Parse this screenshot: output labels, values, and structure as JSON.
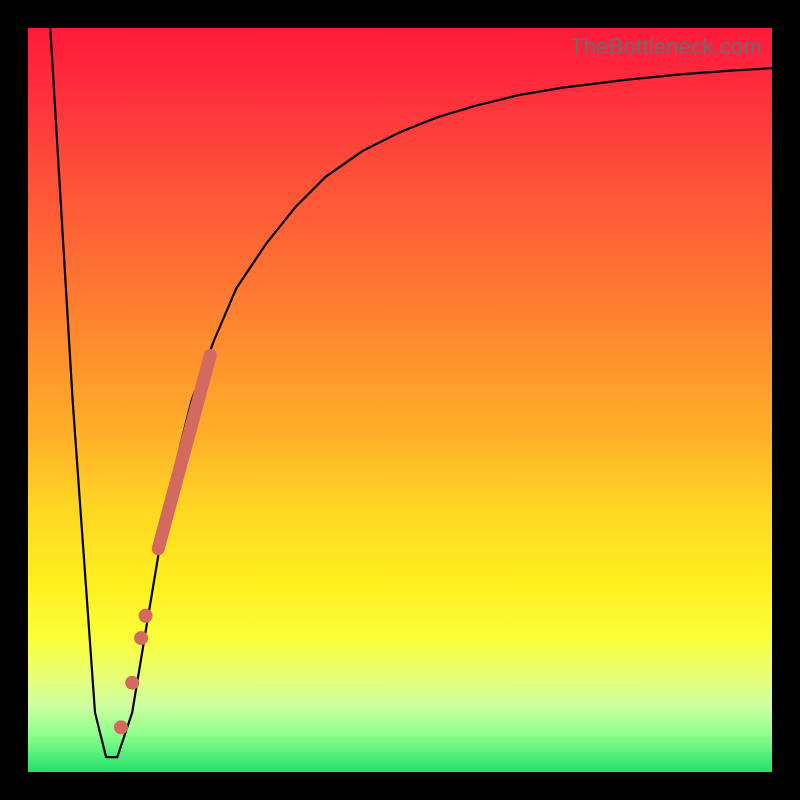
{
  "watermark": "TheBottleneck.com",
  "chart_data": {
    "type": "line",
    "title": "",
    "xlabel": "",
    "ylabel": "",
    "xlim": [
      0,
      100
    ],
    "ylim": [
      0,
      100
    ],
    "grid": false,
    "series": [
      {
        "name": "bottleneck-curve",
        "x": [
          3,
          6,
          9,
          10.5,
          12,
          14,
          16,
          18,
          20,
          22,
          25,
          28,
          32,
          36,
          40,
          45,
          50,
          55,
          60,
          66,
          72,
          80,
          88,
          95,
          100
        ],
        "y": [
          100,
          50,
          8,
          2,
          2,
          8,
          20,
          32,
          42,
          50,
          58,
          65,
          71,
          76,
          80,
          83.5,
          86,
          88,
          89.5,
          91,
          92,
          93,
          93.8,
          94.3,
          94.6
        ]
      }
    ],
    "highlight_segment": {
      "name": "salmon-band",
      "x": [
        17.5,
        24.5
      ],
      "y": [
        30,
        56
      ]
    },
    "highlight_points": [
      {
        "x": 15.2,
        "y": 18
      },
      {
        "x": 15.8,
        "y": 21
      },
      {
        "x": 14.0,
        "y": 12
      },
      {
        "x": 12.5,
        "y": 6
      }
    ],
    "colors": {
      "curve": "#000000",
      "highlight": "#d46a5f",
      "background_top": "#ff1a3a",
      "background_bottom": "#22e06a"
    }
  }
}
